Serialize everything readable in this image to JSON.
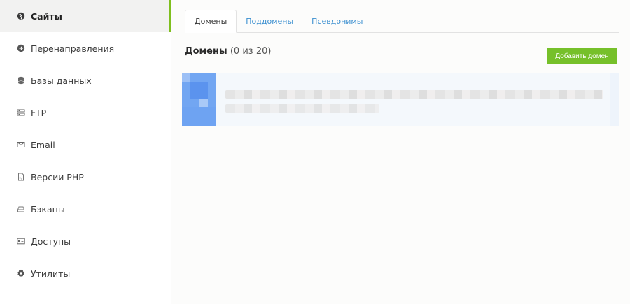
{
  "sidebar": {
    "items": [
      {
        "label": "Сайты",
        "icon": "globe-icon",
        "active": true
      },
      {
        "label": "Перенаправления",
        "icon": "redirect-arrow-icon",
        "active": false
      },
      {
        "label": "Базы данных",
        "icon": "database-icon",
        "active": false
      },
      {
        "label": "FTP",
        "icon": "ftp-server-icon",
        "active": false
      },
      {
        "label": "Email",
        "icon": "envelope-icon",
        "active": false
      },
      {
        "label": "Версии PHP",
        "icon": "php-file-icon",
        "active": false
      },
      {
        "label": "Бэкапы",
        "icon": "backup-drive-icon",
        "active": false
      },
      {
        "label": "Доступы",
        "icon": "id-card-icon",
        "active": false
      },
      {
        "label": "Утилиты",
        "icon": "gear-icon",
        "active": false
      }
    ]
  },
  "tabs": [
    {
      "label": "Домены",
      "active": true
    },
    {
      "label": "Поддомены",
      "active": false
    },
    {
      "label": "Псевдонимы",
      "active": false
    }
  ],
  "main": {
    "title": "Домены",
    "count": "(0 из 20)",
    "add_button": "Добавить домен"
  },
  "colors": {
    "accent_green": "#76c02a",
    "link_blue": "#3b8fd0",
    "active_indicator": "#7fbf1e"
  }
}
